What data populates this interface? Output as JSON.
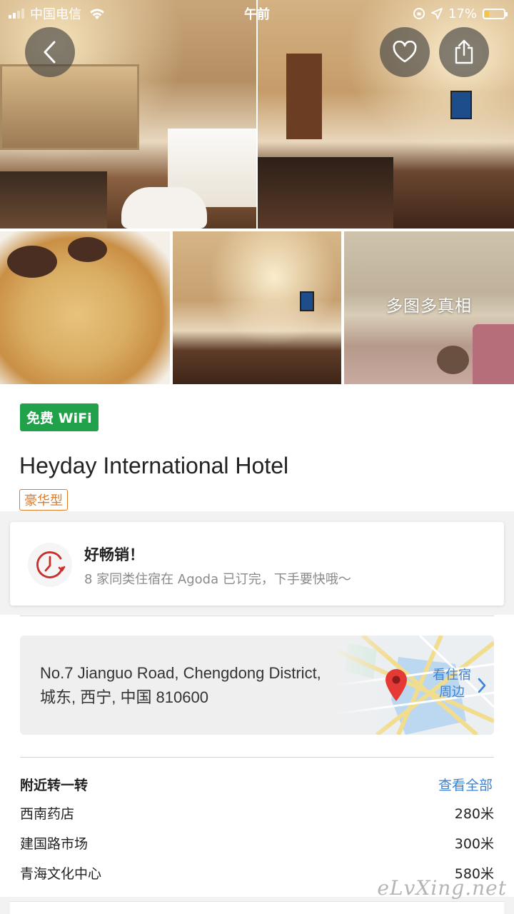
{
  "status_bar": {
    "carrier": "中国电信",
    "time": "午前",
    "battery": "17%",
    "icons": [
      "signal-icon",
      "wifi-icon",
      "orientation-lock-icon",
      "location-arrow-icon",
      "battery-icon"
    ]
  },
  "gallery": {
    "more_photos_label": "多图多真相"
  },
  "header_buttons": {
    "back": "back-arrow-icon",
    "favorite": "heart-icon",
    "share": "share-icon"
  },
  "hotel": {
    "wifi_badge": "免费 WiFi",
    "name": "Heyday International Hotel",
    "category": "豪华型"
  },
  "promo": {
    "title": "好畅销！",
    "subtitle": "8 家同类住宿在 Agoda 已订完，下手要快哦～",
    "icon": "clock-icon"
  },
  "location": {
    "address_line1": "No.7 Jianguo Road, Chengdong District,",
    "address_line2": "城东, 西宁, 中国 810600",
    "map_link": "看住宿周边",
    "icon": "map-pin-icon"
  },
  "nearby": {
    "heading": "附近转一转",
    "view_all": "查看全部",
    "places": [
      {
        "name": "西南药店",
        "distance": "280米"
      },
      {
        "name": "建国路市场",
        "distance": "300米"
      },
      {
        "name": "青海文化中心",
        "distance": "580米"
      }
    ]
  },
  "watermark": "eLvXing.net",
  "colors": {
    "wifi_badge": "#21a24a",
    "category_badge": "#e07a26",
    "link": "#3b82d4",
    "clock": "#c9302c",
    "pin": "#e53935"
  }
}
